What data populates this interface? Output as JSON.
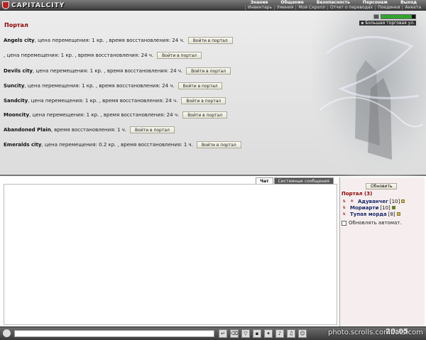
{
  "app": {
    "title": "CAPITALCITY"
  },
  "nav_top": [
    "Знания",
    "Общение",
    "Безопасность",
    "Персонаж",
    "Выход"
  ],
  "nav_sub": [
    "Инвентарь",
    "Умения",
    "Мой Скролл",
    "Отчет о переводах",
    "Поединки",
    "Анкета"
  ],
  "status": {
    "location": "Большая торговая ул.",
    "health_fraction": 0.9
  },
  "page": {
    "title": "Портал"
  },
  "portal_button_label": "Войти в портал",
  "cities": [
    {
      "name": "Angels city",
      "info": ", цена перемещения: 1 кр. , время восстановления: 24 ч."
    },
    {
      "name": "",
      "info": ", цена перемещения: 1 кр. , время восстановления: 24 ч."
    },
    {
      "name": "Devils city",
      "info": ", цена перемещения: 1 кр. , время восстановления: 24 ч."
    },
    {
      "name": "Suncity",
      "info": ", цена перемещения: 1 кр. , время восстановления: 24 ч."
    },
    {
      "name": "Sandcity",
      "info": ", цена перемещения: 1 кр. , время восстановления: 24 ч."
    },
    {
      "name": "Mooncity",
      "info": ", цена перемещения: 1 кр. , время восстановления: 24 ч."
    },
    {
      "name": "Abandoned Plain",
      "info": ", время восстановления: 1 ч."
    },
    {
      "name": "Emeralds city",
      "info": ", цена перемещения: 0.2 кр. , время восстановления: 1 ч."
    }
  ],
  "tabs": [
    {
      "label": "Чат",
      "active": true
    },
    {
      "label": "Системные сообщения",
      "active": false
    }
  ],
  "sidebar": {
    "refresh_label": "Обновить",
    "room_title": "Портал (3)",
    "players": [
      {
        "name": "Адуванчег",
        "level": "[10]"
      },
      {
        "name": "Мориарти",
        "level": "[10]"
      },
      {
        "name": "Тупая морда",
        "level": "[8]"
      }
    ],
    "autorefresh_label": "Обновлять автомат."
  },
  "clock": "20:05",
  "watermark": "photo.scrolls.combats.com"
}
